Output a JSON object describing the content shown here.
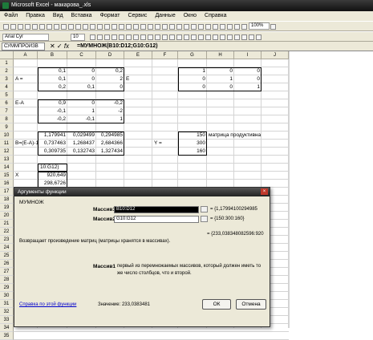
{
  "window": {
    "title": "Microsoft Excel - макарова_.xls"
  },
  "menu": [
    "Файл",
    "Правка",
    "Вид",
    "Вставка",
    "Формат",
    "Сервис",
    "Данные",
    "Окно",
    "Справка"
  ],
  "toolbar": {
    "font_name": "Arial Cyr",
    "font_size": "10",
    "zoom": "100%"
  },
  "formula_bar": {
    "name_box": "СУММПРОИЗВ",
    "formula": "=МУМНОЖ(B10:D12;G10:G12)"
  },
  "columns": [
    "A",
    "B",
    "C",
    "D",
    "E",
    "F",
    "G",
    "H",
    "I",
    "J"
  ],
  "rows": [
    "1",
    "2",
    "3",
    "4",
    "5",
    "6",
    "7",
    "8",
    "9",
    "10",
    "11",
    "12",
    "13",
    "14",
    "15",
    "16",
    "17",
    "18",
    "19",
    "20",
    "21",
    "22",
    "23",
    "24",
    "25",
    "26",
    "27",
    "28",
    "29",
    "30",
    "31",
    "32",
    "33",
    "34",
    "35"
  ],
  "cells": {
    "b2": "0,1",
    "c2": "0",
    "d2": "0,2",
    "a3": "A =",
    "b3": "0,1",
    "c3": "0",
    "d3": "2",
    "b4": "0,2",
    "c4": "0,1",
    "d4": "0",
    "e3": "E",
    "g2": "1",
    "h2": "0",
    "i2": "0",
    "g3": "0",
    "h3": "1",
    "i3": "0",
    "g4": "0",
    "h4": "0",
    "i4": "1",
    "a6": "E-A",
    "b6": "0,9",
    "c6": "0",
    "d6": "-0,2",
    "b7": "-0,1",
    "c7": "1",
    "d7": "-2",
    "b8": "-0,2",
    "c8": "-0,1",
    "d8": "1",
    "b10": "1,179941",
    "c10": "0,029499",
    "d10": "0,294985",
    "a11": "B=(E-A)-1",
    "b11": "0,737463",
    "c11": "1,268437",
    "d11": "2,684366",
    "b12": "0,309735",
    "c12": "0,132743",
    "d12": "1,327434",
    "g10": "150",
    "g11": "300",
    "g12": "160",
    "f11": "Y =",
    "h10": "матрица продуктивна",
    "b14": "10:G12)",
    "a15": "X",
    "b15": "920,649",
    "b16": "298,6726"
  },
  "dialog": {
    "title": "Аргументы функции",
    "function_name": "МУМНОЖ",
    "arg1_label": "Массив1",
    "arg1_value": "B10:D12",
    "arg1_result": "= {1,17994100294985",
    "arg2_label": "Массив2",
    "arg2_value": "G10:G12",
    "arg2_result": "= {150:300:160}",
    "total_result": "= {233,038348082596:920",
    "description": "Возвращает произведение матриц (матрицы хранятся в массивах).",
    "arg_help_label": "Массив1",
    "arg_help_text": "первый из перемножаемых массивов, который должен иметь то же число столбцов, что и второй.",
    "help_link": "Справка по этой функции",
    "value_label": "Значение:",
    "value": "233,0383481",
    "ok": "ОК",
    "cancel": "Отмена"
  }
}
